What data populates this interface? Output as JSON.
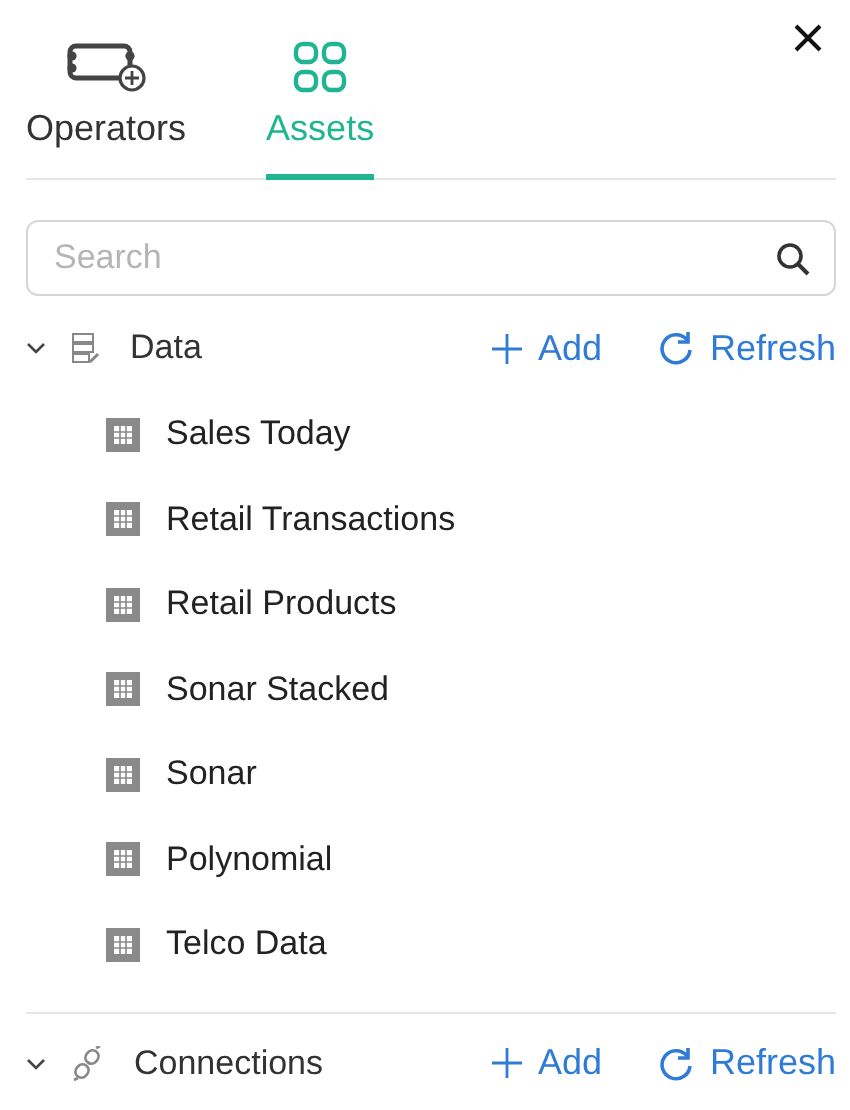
{
  "tabs": [
    {
      "label": "Operators",
      "kind": "operators",
      "selected": false
    },
    {
      "label": "Assets",
      "kind": "assets",
      "selected": true
    }
  ],
  "search": {
    "placeholder": "Search"
  },
  "sections": [
    {
      "title": "Data",
      "kind": "data",
      "expanded": true,
      "add": "Add",
      "refresh": "Refresh",
      "items": [
        "Sales Today",
        "Retail Transactions",
        "Retail Products",
        "Sonar Stacked",
        "Sonar",
        "Polynomial",
        "Telco Data"
      ]
    },
    {
      "title": "Connections",
      "kind": "connections",
      "expanded": true,
      "add": "Add",
      "refresh": "Refresh"
    }
  ]
}
